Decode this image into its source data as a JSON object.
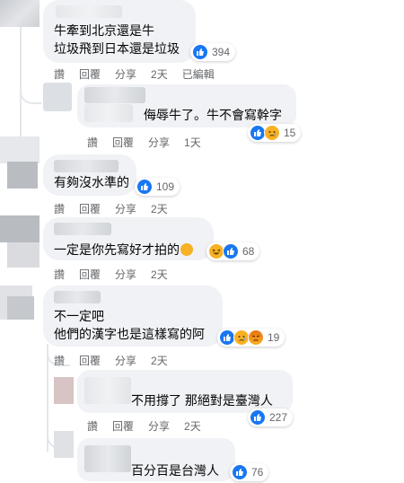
{
  "actions": {
    "like": "讚",
    "reply": "回覆",
    "share": "分享",
    "edited": "已編輯"
  },
  "comments": [
    {
      "lines": [
        "牛牽到北京還是牛",
        "垃圾飛到日本還是垃圾"
      ],
      "reactions": [
        "like"
      ],
      "count": "394",
      "time": "2天",
      "edited": true
    },
    {
      "lines": [
        "侮辱牛了。牛不會寫幹字"
      ],
      "reactions": [
        "like",
        "sad"
      ],
      "count": "15",
      "time": "1天"
    },
    {
      "lines": [
        "有夠沒水準的"
      ],
      "reactions": [
        "like"
      ],
      "count": "109",
      "time": "2天"
    },
    {
      "lines": [
        "一定是你先寫好才拍的"
      ],
      "reactions": [
        "haha",
        "like"
      ],
      "count": "68",
      "time": "2天"
    },
    {
      "lines": [
        "不一定吧",
        "他們的漢字也是這樣寫的阿"
      ],
      "reactions": [
        "like",
        "sad",
        "angry"
      ],
      "count": "19",
      "time": "2天"
    },
    {
      "lines": [
        "不用撐了 那絕對是臺灣人"
      ],
      "reactions": [
        "like"
      ],
      "count": "227",
      "time": "2天"
    },
    {
      "lines": [
        "百分百是台灣人"
      ],
      "reactions": [
        "like"
      ],
      "count": "76"
    }
  ],
  "colors": {
    "bubble": "#f0f2f5",
    "like": "#1877f2",
    "emoji": "#f7b125",
    "meta_text": "#65676b"
  }
}
